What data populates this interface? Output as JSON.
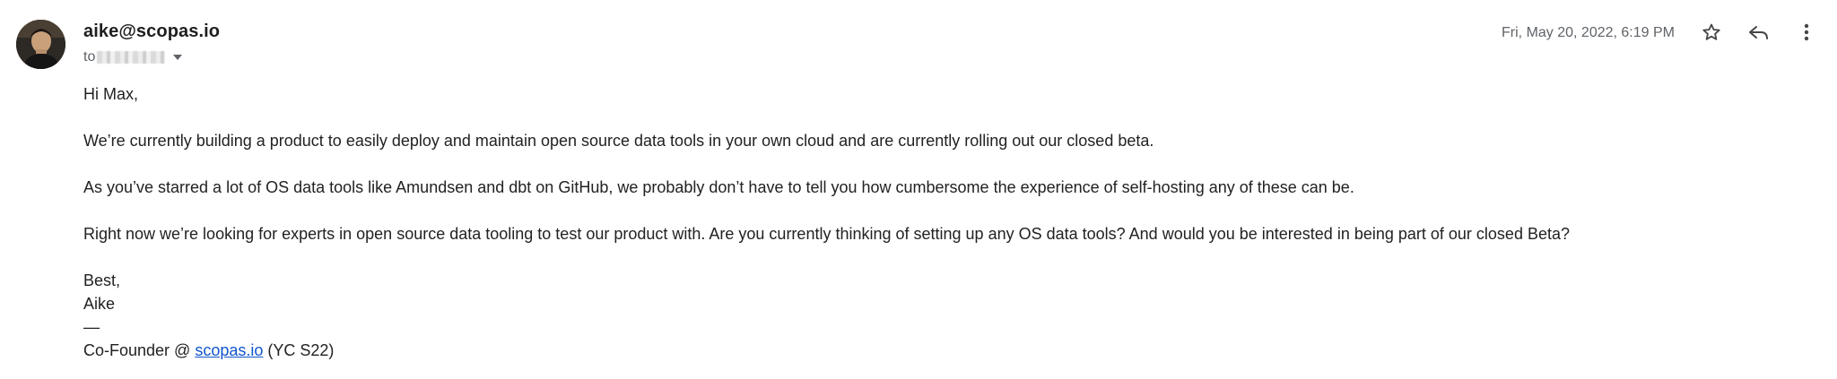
{
  "message": {
    "sender": "aike@scopas.io",
    "to_label": "to",
    "date": "Fri, May 20, 2022, 6:19 PM"
  },
  "body": {
    "greeting": "Hi Max,",
    "p1": "We’re currently building a product to easily deploy and maintain open source data tools in your own cloud and are currently rolling out our closed beta.",
    "p2": "As you’ve starred a lot of OS data tools like Amundsen and dbt on GitHub, we probably don’t have to tell you how cumbersome the experience of self-hosting any of these can be.",
    "p3": "Right now we’re looking for experts in open source data tooling to test our product with. Are you currently thinking of setting up any OS data tools? And would you be interested in being part of our closed Beta?",
    "signoff": "Best,",
    "name": "Aike",
    "dash": "—",
    "title_prefix": "Co-Founder @ ",
    "title_link": "scopas.io",
    "title_suffix": " (YC S22)"
  },
  "icons": {
    "star": "star-icon",
    "reply": "reply-icon",
    "more": "more-vertical-icon"
  }
}
